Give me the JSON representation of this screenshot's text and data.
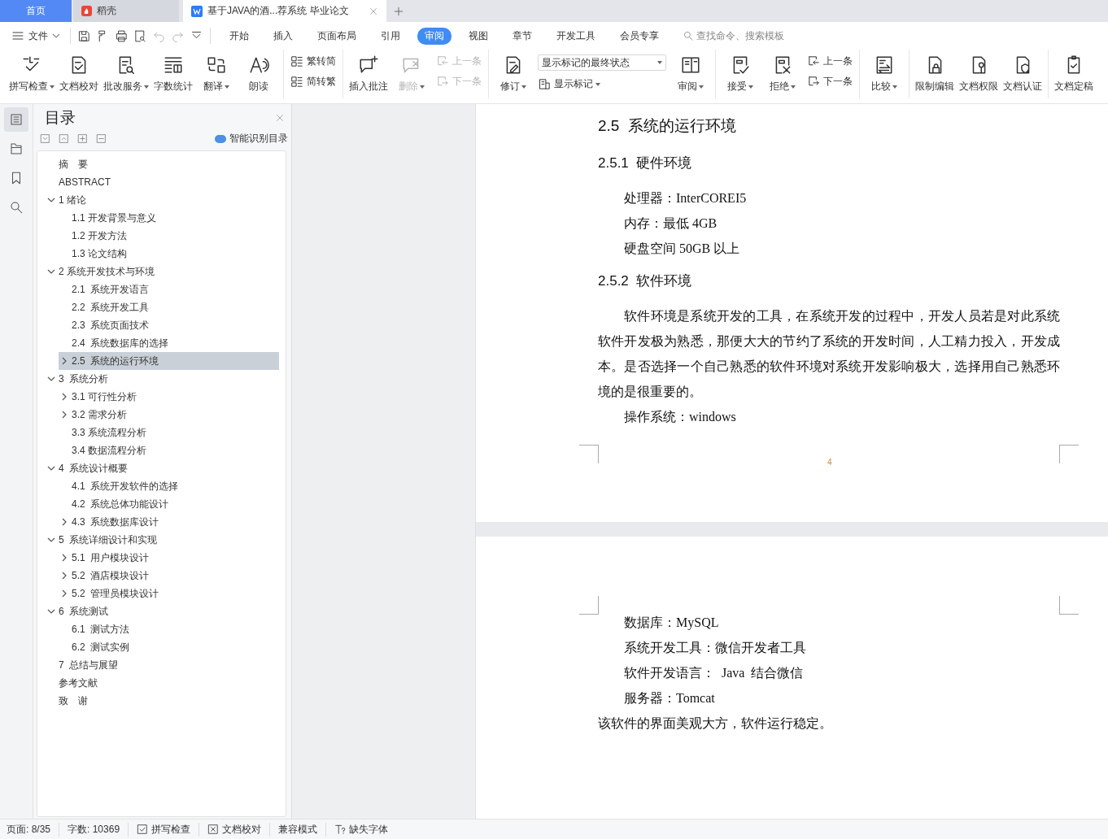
{
  "tabs": [
    {
      "label": "首页",
      "kind": "home",
      "selected": false
    },
    {
      "label": "稻壳",
      "kind": "daoke",
      "selected": false
    },
    {
      "label": "基于JAVA的酒...荐系统 毕业论文",
      "kind": "doc",
      "selected": true
    }
  ],
  "menu": {
    "file": "文件",
    "quick_access": [
      {
        "disabled": false
      },
      {
        "disabled": false
      },
      {
        "disabled": false
      },
      {
        "disabled": false
      },
      {
        "disabled": true
      },
      {
        "disabled": true
      },
      {
        "disabled": false
      }
    ],
    "tabs": [
      {
        "label": "开始",
        "selected": false
      },
      {
        "label": "插入",
        "selected": false
      },
      {
        "label": "页面布局",
        "selected": false
      },
      {
        "label": "引用",
        "selected": false
      },
      {
        "label": "审阅",
        "selected": true
      },
      {
        "label": "视图",
        "selected": false
      },
      {
        "label": "章节",
        "selected": false
      },
      {
        "label": "开发工具",
        "selected": false
      },
      {
        "label": "会员专享",
        "selected": false
      }
    ],
    "search": {
      "placeholder": "查找命令、搜索模板"
    }
  },
  "ribbon": {
    "groups": [
      {
        "items": [
          {
            "kind": "large",
            "label": "拼写检查",
            "dropdown": true,
            "disabled": false
          },
          {
            "kind": "large",
            "label": "文档校对",
            "dropdown": false,
            "disabled": false
          },
          {
            "kind": "large",
            "label": "批改服务",
            "dropdown": true,
            "disabled": false
          },
          {
            "kind": "large",
            "label": "字数统计",
            "dropdown": false,
            "disabled": false
          },
          {
            "kind": "large",
            "label": "翻译",
            "dropdown": true,
            "disabled": false
          },
          {
            "kind": "large",
            "label": "朗读",
            "dropdown": false,
            "disabled": false
          }
        ]
      },
      {
        "items": [
          {
            "kind": "stack",
            "items": [
              {
                "label": "繁转简",
                "dropdown": false,
                "disabled": false
              },
              {
                "label": "简转繁",
                "dropdown": false,
                "disabled": false
              }
            ]
          }
        ]
      },
      {
        "items": [
          {
            "kind": "large",
            "label": "插入批注",
            "dropdown": false,
            "disabled": false
          },
          {
            "kind": "large",
            "label": "删除",
            "dropdown": true,
            "disabled": true
          },
          {
            "kind": "stack",
            "items": [
              {
                "label": "上一条",
                "dropdown": false,
                "disabled": true
              },
              {
                "label": "下一条",
                "dropdown": false,
                "disabled": true
              }
            ]
          }
        ]
      },
      {
        "items": [
          {
            "kind": "large",
            "label": "修订",
            "dropdown": true,
            "disabled": false
          },
          {
            "kind": "stack",
            "items": [
              {
                "kind": "select",
                "label": "显示标记的最终状态",
                "dropdown": true,
                "disabled": false
              },
              {
                "label": "显示标记",
                "dropdown": true,
                "disabled": false
              }
            ]
          },
          {
            "kind": "large",
            "label": "审阅",
            "dropdown": true,
            "disabled": false
          }
        ]
      },
      {
        "items": [
          {
            "kind": "large",
            "label": "接受",
            "dropdown": true,
            "disabled": false
          },
          {
            "kind": "large",
            "label": "拒绝",
            "dropdown": true,
            "disabled": false
          },
          {
            "kind": "stack",
            "items": [
              {
                "label": "上一条",
                "dropdown": false,
                "disabled": false
              },
              {
                "label": "下一条",
                "dropdown": false,
                "disabled": false
              }
            ]
          }
        ]
      },
      {
        "items": [
          {
            "kind": "large",
            "label": "比较",
            "dropdown": true,
            "disabled": false
          }
        ]
      },
      {
        "items": [
          {
            "kind": "large",
            "label": "限制编辑",
            "dropdown": false,
            "disabled": false
          },
          {
            "kind": "large",
            "label": "文档权限",
            "dropdown": false,
            "disabled": false
          },
          {
            "kind": "large",
            "label": "文档认证",
            "dropdown": false,
            "disabled": false
          }
        ]
      },
      {
        "items": [
          {
            "kind": "large",
            "label": "文档定稿",
            "dropdown": false,
            "disabled": false
          }
        ]
      }
    ]
  },
  "sidebar": {
    "tools": [
      {
        "selected": true
      },
      {
        "selected": false
      },
      {
        "selected": false
      },
      {
        "selected": false
      }
    ],
    "title": "目录",
    "smart_toc": "智能识别目录",
    "toc": [
      {
        "label": "摘　要",
        "selected": false
      },
      {
        "label": "ABSTRACT",
        "selected": false
      },
      {
        "label": "1 绪论",
        "selected": false,
        "expanded": true,
        "children": [
          {
            "label": "1.1 开发背景与意义",
            "selected": false
          },
          {
            "label": "1.2 开发方法",
            "selected": false
          },
          {
            "label": "1.3 论文结构",
            "selected": false
          }
        ]
      },
      {
        "label": "2 系统开发技术与环境",
        "selected": false,
        "expanded": true,
        "children": [
          {
            "label": "2.1  系统开发语言",
            "selected": false
          },
          {
            "label": "2.2  系统开发工具",
            "selected": false
          },
          {
            "label": "2.3  系统页面技术",
            "selected": false
          },
          {
            "label": "2.4  系统数据库的选择",
            "selected": false
          },
          {
            "label": "2.5  系统的运行环境",
            "selected": true,
            "expanded": false
          }
        ]
      },
      {
        "label": "3  系统分析",
        "selected": false,
        "expanded": true,
        "children": [
          {
            "label": "3.1 可行性分析",
            "selected": false,
            "expanded": false
          },
          {
            "label": "3.2 需求分析",
            "selected": false,
            "expanded": false
          },
          {
            "label": "3.3 系统流程分析",
            "selected": false
          },
          {
            "label": "3.4 数据流程分析",
            "selected": false
          }
        ]
      },
      {
        "label": "4  系统设计概要",
        "selected": false,
        "expanded": true,
        "children": [
          {
            "label": "4.1  系统开发软件的选择",
            "selected": false
          },
          {
            "label": "4.2  系统总体功能设计",
            "selected": false
          },
          {
            "label": "4.3  系统数据库设计",
            "selected": false,
            "expanded": false
          }
        ]
      },
      {
        "label": "5  系统详细设计和实现",
        "selected": false,
        "expanded": true,
        "children": [
          {
            "label": "5.1  用户模块设计",
            "selected": false,
            "expanded": false
          },
          {
            "label": "5.2  酒店模块设计",
            "selected": false,
            "expanded": false
          },
          {
            "label": "5.2  管理员模块设计",
            "selected": false,
            "expanded": false
          }
        ]
      },
      {
        "label": "6  系统测试",
        "selected": false,
        "expanded": true,
        "children": [
          {
            "label": "6.1  测试方法",
            "selected": false
          },
          {
            "label": "6.2  测试实例",
            "selected": false
          }
        ]
      },
      {
        "label": "7  总结与展望",
        "selected": false
      },
      {
        "label": "参考文献",
        "selected": false
      },
      {
        "label": "致　谢",
        "selected": false
      }
    ]
  },
  "document": {
    "pages": [
      {
        "page_number": "4",
        "blocks": [
          {
            "kind": "h2",
            "text": "2.5  系统的运行环境"
          },
          {
            "kind": "h3",
            "text": "2.5.1  硬件环境"
          },
          {
            "kind": "line",
            "text": "处理器：InterCOREI5"
          },
          {
            "kind": "line",
            "text": "内存：最低 4GB"
          },
          {
            "kind": "line",
            "text": "硬盘空间 50GB 以上"
          },
          {
            "kind": "h3",
            "text": "2.5.2  软件环境"
          },
          {
            "kind": "para",
            "text": "软件环境是系统开发的工具，在系统开发的过程中，开发人员若是对此系统软件开发极为熟悉，那便大大的节约了系统的开发时间，人工精力投入，开发成本。是否选择一个自己熟悉的软件环境对系统开发影响极大，选择用自己熟悉环境的是很重要的。"
          },
          {
            "kind": "line",
            "text": "操作系统：windows"
          }
        ]
      },
      {
        "blocks": [
          {
            "kind": "line",
            "text": "数据库：MySQL"
          },
          {
            "kind": "line",
            "text": "系统开发工具：微信开发者工具"
          },
          {
            "kind": "line",
            "text": "软件开发语言：  Java  结合微信"
          },
          {
            "kind": "line",
            "text": "服务器：Tomcat"
          },
          {
            "kind": "flush",
            "text": "该软件的界面美观大方，软件运行稳定。"
          }
        ]
      }
    ]
  },
  "status_bar": {
    "items": [
      {
        "kind": "text",
        "label": "页面: 8/35"
      },
      {
        "kind": "text",
        "label": "字数: 10369"
      },
      {
        "kind": "check",
        "label": "拼写检查"
      },
      {
        "kind": "cross",
        "label": "文档校对"
      },
      {
        "kind": "text",
        "label": "兼容模式"
      },
      {
        "kind": "font",
        "label": "缺失字体"
      }
    ]
  }
}
